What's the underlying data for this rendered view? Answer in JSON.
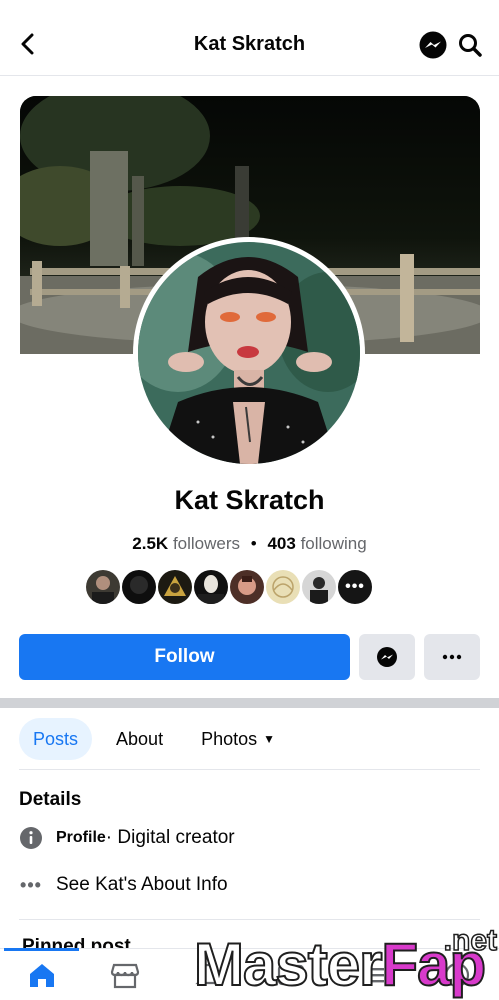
{
  "header": {
    "title": "Kat Skratch",
    "back_icon": "chevron-left-icon",
    "messenger_icon": "messenger-icon",
    "search_icon": "search-icon"
  },
  "profile": {
    "name": "Kat Skratch",
    "followers_count": "2.5K",
    "followers_label": "followers",
    "separator": "•",
    "following_count": "403",
    "following_label": "following",
    "mutual_avatars_count": 8,
    "more_label": "•••"
  },
  "actions": {
    "follow_label": "Follow",
    "message_icon": "messenger-icon",
    "more_icon": "more-horizontal-icon"
  },
  "tabs": [
    {
      "label": "Posts",
      "active": true
    },
    {
      "label": "About",
      "active": false
    },
    {
      "label": "Photos",
      "active": false,
      "dropdown": "▼"
    }
  ],
  "details": {
    "title": "Details",
    "profile_label": "Profile",
    "profile_value": " · Digital creator",
    "about_link": "See Kat's About Info",
    "dots": "•••"
  },
  "pinned": {
    "label": "Pinned post"
  },
  "bottom_nav": [
    {
      "icon": "home-icon",
      "active": true
    },
    {
      "icon": "marketplace-icon",
      "active": false
    },
    {
      "icon": "notifications-icon",
      "active": false
    },
    {
      "icon": "video-icon",
      "active": false
    },
    {
      "icon": "menu-icon",
      "active": false
    },
    {
      "icon": "profile-icon",
      "active": false
    }
  ],
  "watermark": {
    "main": "Master",
    "accent": "Fap",
    "suffix": ".net"
  },
  "colors": {
    "brand_blue": "#1877f2",
    "tab_active_bg": "#e7f3ff",
    "button_gray": "#e4e6eb",
    "watermark_accent": "#d83acb"
  }
}
